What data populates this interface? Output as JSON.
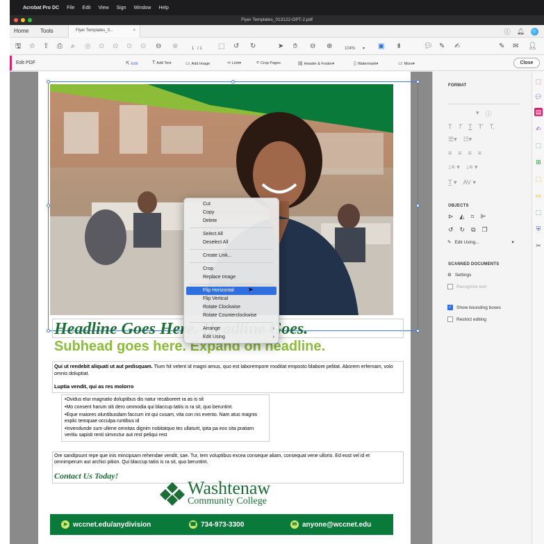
{
  "menubar": {
    "app": "Acrobat Pro DC",
    "items": [
      "File",
      "Edit",
      "View",
      "Sign",
      "Window",
      "Help"
    ]
  },
  "window": {
    "title": "Flyer Templates_013122-OPT-2.pdf"
  },
  "tabs": {
    "home": "Home",
    "tools": "Tools",
    "document": "Flyer Templates_0...",
    "close": "×"
  },
  "toolbar": {
    "page_current": "1",
    "page_total": "/ 1",
    "zoom": "104%"
  },
  "editbar": {
    "label": "Edit PDF",
    "buttons": [
      "Edit",
      "Add Text",
      "Add Image",
      "Link",
      "Crop Pages",
      "Header & Footer",
      "Watermark",
      "More"
    ],
    "close": "Close"
  },
  "flyer": {
    "headline": "Headline Goes Here. Headline Goes.",
    "subhead": "Subhead goes here. Expand on headline.",
    "para_bold": "Qui ut rendebit aliquati ut aut pedisquam.",
    "para_rest": " Tium hit velent id magni amus, quo est laborempore moditat emposto blabore pelitat. Aborem erfernam, volo omnis doluptiat.",
    "subtitle": "Luptia vendit, qui as res molorro",
    "bullets": [
      "•Ovidus elur magnatio doluptibus dis natur recaboreet ra as is sit",
      "•Mo consent harum siti dero ommodia qui blaccup tatiis is ra sit, quo beruntint.",
      "•Eque maiores oluntibusdam faccum int qui cusam, vita con nis evento. Nam atus magnis explic temquae occulpa runtibus id",
      "•Invendunde sum ullene omnitas dignim nobitatquo tes ullaturit, ipita pa eos sita pratiam veritiu sapisti renti simınctur aut rest peliqui rest"
    ],
    "para2": "Ore sandipsunt repe que inis mincipsam rehendae vendit, sae. Tur, tem voluptibus excea conseque aliam, consequat vene ullorio. Ed eost vel id et omnimperum aut archici pition. Qui blaccup tatiis is ra sit, quo beruntint.",
    "contact": "Contact Us Today!",
    "logo_name": "Washtenaw",
    "logo_sub": "Community College",
    "footer": {
      "web": "wccnet.edu/anydivision",
      "phone": "734-973-3300",
      "email": "anyone@wccnet.edu"
    }
  },
  "context_menu": {
    "group1": [
      "Cut",
      "Copy",
      "Delete"
    ],
    "group2": [
      "Select All",
      "Deselect All"
    ],
    "group3": [
      "Create Link..."
    ],
    "group4": [
      "Crop",
      "Replace Image"
    ],
    "group5": [
      "Flip Horizontal",
      "Flip Vertical",
      "Rotate Clockwise",
      "Rotate Counterclockwise"
    ],
    "group6": [
      "Arrange",
      "Edit Using"
    ],
    "highlighted": "Flip Horizontal"
  },
  "panel": {
    "format": "FORMAT",
    "objects": "OBJECTS",
    "edit_using": "Edit Using...",
    "scanned": "SCANNED DOCUMENTS",
    "settings": "Settings",
    "recognize": "Recognize text",
    "show_bounding": "Show bounding boxes",
    "restrict": "Restrict editing"
  },
  "colors": {
    "brand_green": "#0a7a3a",
    "lime": "#8cbc38",
    "accent": "#d6246e",
    "selection": "#2f6fde"
  }
}
